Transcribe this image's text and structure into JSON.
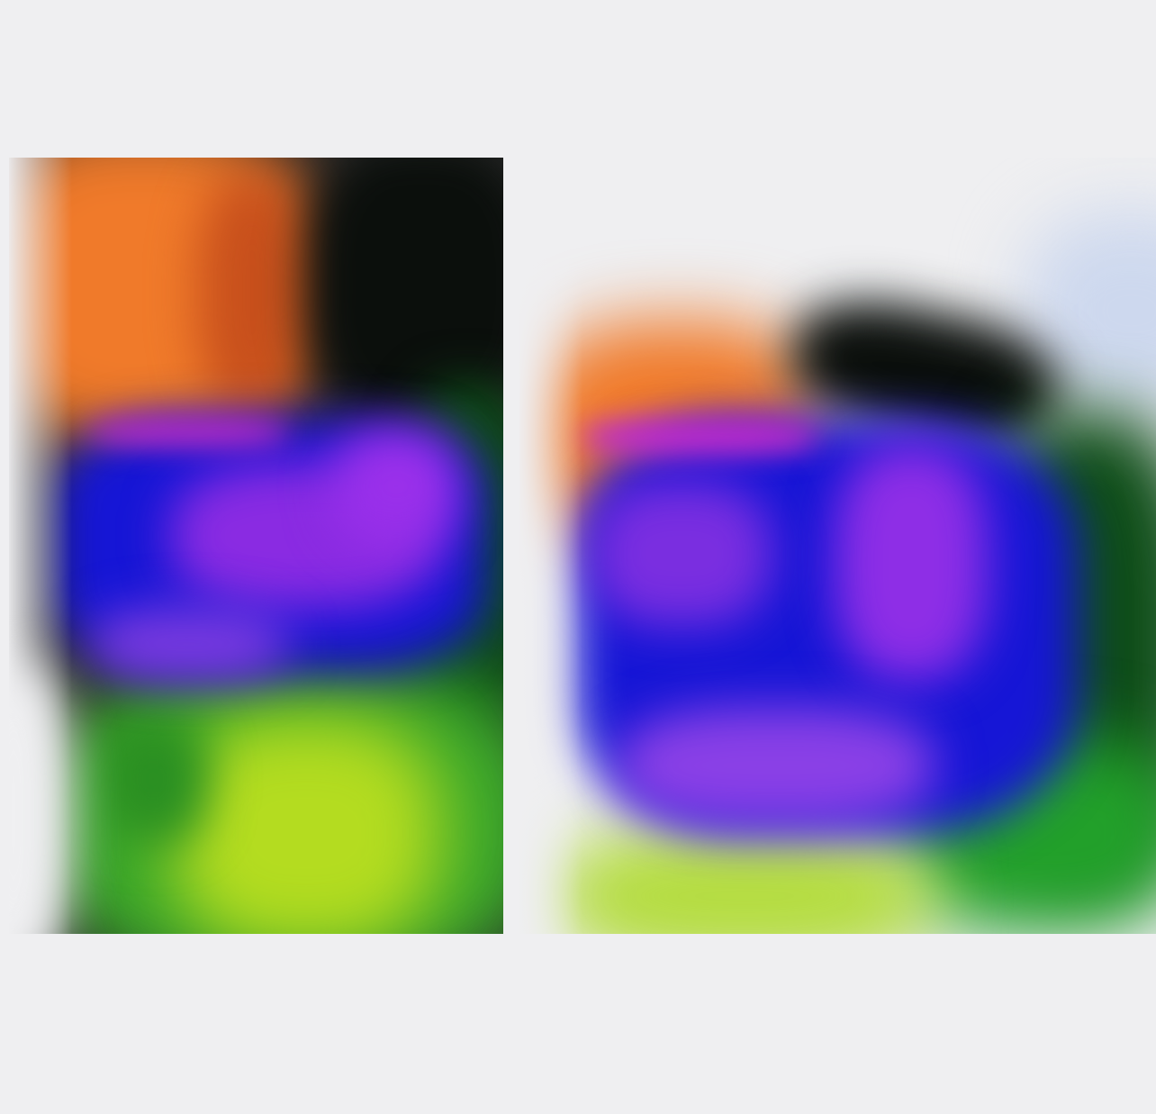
{
  "background_color": "#efeff1",
  "panels": [
    {
      "name": "left-image-panel",
      "description_colors": [
        "#f07a2a",
        "#0b0f0c",
        "#1515d8",
        "#8a2be2",
        "#a8d828",
        "#25a82a"
      ]
    },
    {
      "name": "right-image-panel",
      "description_colors": [
        "#f07a2a",
        "#0b0f0c",
        "#1515d8",
        "#8a2be2",
        "#a8d828",
        "#1f7a1f"
      ]
    }
  ]
}
